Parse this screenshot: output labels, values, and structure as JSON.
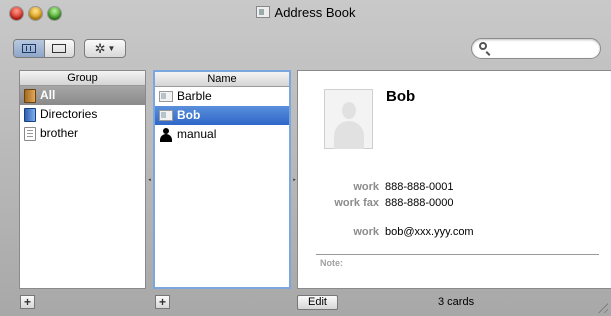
{
  "window": {
    "title": "Address Book"
  },
  "toolbar": {
    "search": {
      "value": "",
      "placeholder": ""
    }
  },
  "groups": {
    "header": "Group",
    "items": [
      {
        "label": "All",
        "icon": "all-contacts-icon",
        "selected": true
      },
      {
        "label": "Directories",
        "icon": "directories-icon",
        "selected": false
      },
      {
        "label": "brother",
        "icon": "group-icon",
        "selected": false
      }
    ]
  },
  "names": {
    "header": "Name",
    "items": [
      {
        "label": "Barble",
        "icon": "vcard-icon",
        "selected": false
      },
      {
        "label": "Bob",
        "icon": "vcard-icon",
        "selected": true
      },
      {
        "label": "manual",
        "icon": "person-icon",
        "selected": false
      }
    ]
  },
  "card": {
    "name": "Bob",
    "fields": [
      {
        "label": "work",
        "value": "888-888-0001"
      },
      {
        "label": "work fax",
        "value": "888-888-0000"
      },
      {
        "label": "work",
        "value": "bob@xxx.yyy.com"
      }
    ],
    "note_label": "Note:"
  },
  "footer": {
    "add_label": "+",
    "edit_label": "Edit",
    "count": "3 cards"
  }
}
